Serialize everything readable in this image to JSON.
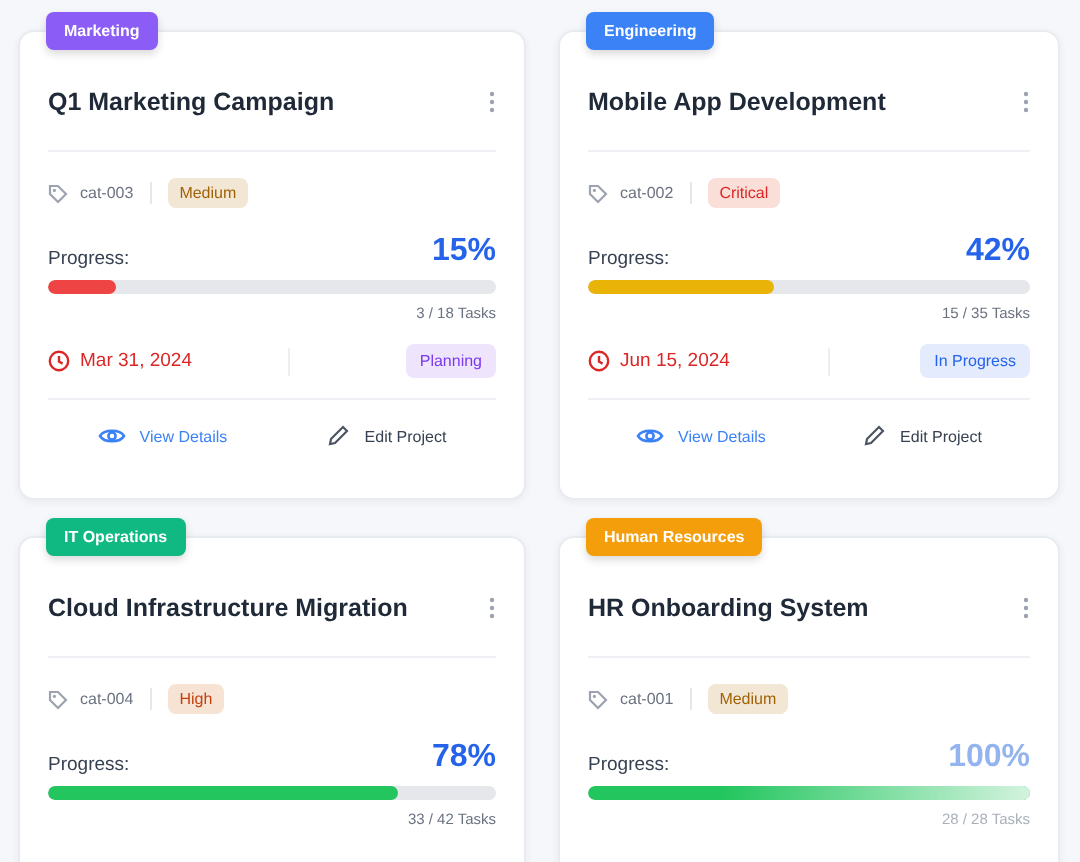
{
  "projects": [
    {
      "category": {
        "label": "Marketing",
        "color": "#8b5cf6"
      },
      "title": "Q1 Marketing Campaign",
      "code": "cat-003",
      "priority": {
        "label": "Medium",
        "color": "#a16207"
      },
      "progress_label": "Progress:",
      "percent": "15%",
      "progress": {
        "level": 0.15,
        "color": "#ef4444"
      },
      "tasks": "3 / 18 Tasks",
      "due": "Mar 31, 2024",
      "status": {
        "label": "Planning",
        "color": "#7c3aed"
      },
      "faded": false,
      "actions": [
        {
          "label": "View Details",
          "kind": "view"
        },
        {
          "label": "Edit Project",
          "kind": "edit"
        }
      ]
    },
    {
      "category": {
        "label": "Engineering",
        "color": "#3b82f6"
      },
      "title": "Mobile App Development",
      "code": "cat-002",
      "priority": {
        "label": "Critical",
        "color": "#dc2626"
      },
      "progress_label": "Progress:",
      "percent": "42%",
      "progress": {
        "level": 0.42,
        "color": "#eab308"
      },
      "tasks": "15 / 35 Tasks",
      "due": "Jun 15, 2024",
      "status": {
        "label": "In Progress",
        "color": "#2563eb"
      },
      "faded": false,
      "actions": [
        {
          "label": "View Details",
          "kind": "view"
        },
        {
          "label": "Edit Project",
          "kind": "edit"
        }
      ]
    },
    {
      "category": {
        "label": "IT Operations",
        "color": "#10b981"
      },
      "title": "Cloud Infrastructure Migration",
      "code": "cat-004",
      "priority": {
        "label": "High",
        "color": "#c2410c"
      },
      "progress_label": "Progress:",
      "percent": "78%",
      "progress": {
        "level": 0.78,
        "color": "#22c55e"
      },
      "tasks": "33 / 42 Tasks",
      "faded": false
    },
    {
      "category": {
        "label": "Human Resources",
        "color": "#f59e0b"
      },
      "title": "HR Onboarding System",
      "code": "cat-001",
      "priority": {
        "label": "Medium",
        "color": "#a16207"
      },
      "progress_label": "Progress:",
      "percent": "100%",
      "progress": {
        "level": 1,
        "color": "#22c55e"
      },
      "tasks": "28 / 28 Tasks",
      "faded": true
    }
  ]
}
